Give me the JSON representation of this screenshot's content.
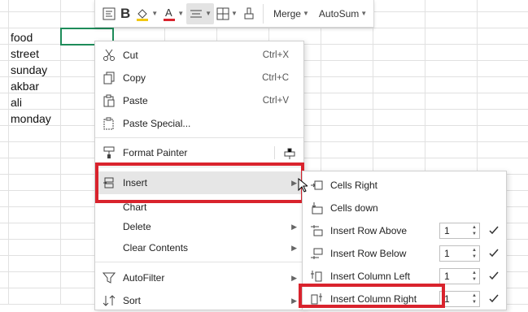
{
  "sheet": {
    "cells": [
      "food",
      "street",
      "sunday",
      "akbar",
      "ali",
      "monday"
    ]
  },
  "toolbar": {
    "merge_label": "Merge",
    "autosum_label": "AutoSum",
    "font_color": "#d9232d",
    "fill_color": "#f2c811"
  },
  "context_menu": {
    "cut": {
      "label": "Cut",
      "shortcut": "Ctrl+X"
    },
    "copy": {
      "label": "Copy",
      "shortcut": "Ctrl+C"
    },
    "paste": {
      "label": "Paste",
      "shortcut": "Ctrl+V"
    },
    "paste_special": {
      "label": "Paste Special..."
    },
    "format_painter": {
      "label": "Format Painter"
    },
    "insert": {
      "label": "Insert"
    },
    "chart": {
      "label": "Chart"
    },
    "delete": {
      "label": "Delete"
    },
    "clear_contents": {
      "label": "Clear Contents"
    },
    "autofilter": {
      "label": "AutoFilter"
    },
    "sort": {
      "label": "Sort"
    }
  },
  "insert_submenu": {
    "cells_right": {
      "label": "Cells Right"
    },
    "cells_down": {
      "label": "Cells down"
    },
    "row_above": {
      "label": "Insert Row Above",
      "count": "1"
    },
    "row_below": {
      "label": "Insert Row Below",
      "count": "1"
    },
    "col_left": {
      "label": "Insert Column Left",
      "count": "1"
    },
    "col_right": {
      "label": "Insert Column Right",
      "count": "1"
    }
  },
  "colors": {
    "highlight_border": "#d9232d",
    "active_cell_border": "#1e8c5a",
    "check": "#333333"
  }
}
